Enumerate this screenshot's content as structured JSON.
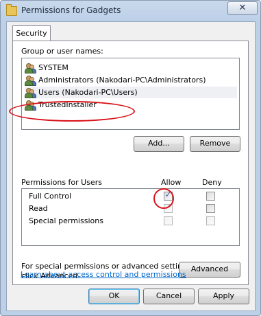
{
  "window": {
    "title": "Permissions for Gadgets",
    "close_glyph": "✕"
  },
  "tabs": [
    {
      "label": "Security"
    }
  ],
  "groups": {
    "label": "Group or user names:",
    "items": [
      {
        "name": "SYSTEM",
        "selected": false
      },
      {
        "name": "Administrators (Nakodari-PC\\Administrators)",
        "selected": false
      },
      {
        "name": "Users (Nakodari-PC\\Users)",
        "selected": true
      },
      {
        "name": "TrustedInstaller",
        "selected": false
      }
    ],
    "add_label": "Add...",
    "remove_label": "Remove"
  },
  "permissions": {
    "title": "Permissions for Users",
    "allow_label": "Allow",
    "deny_label": "Deny",
    "rows": [
      {
        "name": "Full Control",
        "allow": true,
        "deny": false
      },
      {
        "name": "Read",
        "allow": true,
        "deny": false
      },
      {
        "name": "Special permissions",
        "allow": false,
        "deny": false
      }
    ]
  },
  "advanced": {
    "text_line1": "For special permissions or advanced settings,",
    "text_line2": "click Advanced.",
    "button_label": "Advanced"
  },
  "help_link": "Learn about access control and permissions",
  "footer": {
    "ok_label": "OK",
    "cancel_label": "Cancel",
    "apply_label": "Apply"
  },
  "colors": {
    "annotation": "#d8141a",
    "link": "#0066cc"
  }
}
